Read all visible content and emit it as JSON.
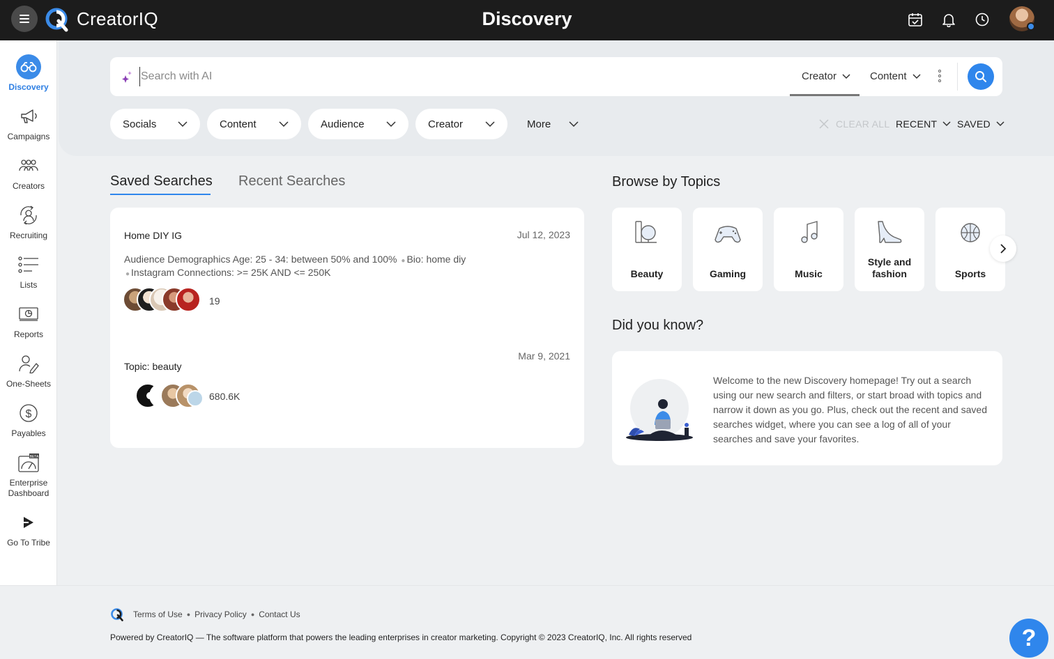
{
  "app": {
    "brand": "CreatorIQ",
    "page_title": "Discovery"
  },
  "header_icons": [
    "calendar-check-icon",
    "bell-icon",
    "clock-icon",
    "user-avatar"
  ],
  "sidebar": {
    "items": [
      {
        "label": "Discovery",
        "icon": "binoculars-icon",
        "active": true
      },
      {
        "label": "Campaigns",
        "icon": "megaphone-icon"
      },
      {
        "label": "Creators",
        "icon": "people-icon"
      },
      {
        "label": "Recruiting",
        "icon": "recruiting-icon"
      },
      {
        "label": "Lists",
        "icon": "list-icon"
      },
      {
        "label": "Reports",
        "icon": "report-icon"
      },
      {
        "label": "One-Sheets",
        "icon": "one-sheet-icon"
      },
      {
        "label": "Payables",
        "icon": "dollar-icon"
      },
      {
        "label": "Enterprise Dashboard",
        "icon": "dashboard-icon",
        "badge": "BETA"
      },
      {
        "label": "Go To Tribe",
        "icon": "tribe-icon"
      }
    ]
  },
  "search": {
    "placeholder": "Search with AI",
    "types": [
      "Creator",
      "Content"
    ],
    "active_type": "Creator"
  },
  "filters": {
    "pills": [
      "Socials",
      "Content",
      "Audience",
      "Creator"
    ],
    "more": "More",
    "clear_all": "CLEAR ALL",
    "recent": "RECENT",
    "saved": "SAVED"
  },
  "searches_tabs": {
    "saved": "Saved Searches",
    "recent": "Recent Searches",
    "active": "saved"
  },
  "saved_searches": [
    {
      "title": "Home DIY IG",
      "date": "Jul 12, 2023",
      "desc_part1": "Audience Demographics Age: 25 - 34: between 50% and 100%",
      "desc_part2": "Bio: home diy",
      "desc_part3": "Instagram Connections: >= 25K AND <= 250K",
      "count": "19"
    },
    {
      "title": "Topic: beauty",
      "date": "Mar 9, 2021",
      "count": "680.6K"
    }
  ],
  "browse": {
    "title": "Browse by Topics",
    "topics": [
      {
        "label": "Beauty",
        "icon": "mirror-icon"
      },
      {
        "label": "Gaming",
        "icon": "gamepad-icon"
      },
      {
        "label": "Music",
        "icon": "music-note-icon"
      },
      {
        "label": "Style and fashion",
        "icon": "high-heel-icon"
      },
      {
        "label": "Sports",
        "icon": "basketball-icon"
      }
    ]
  },
  "did_you_know": {
    "title": "Did you know?",
    "text": "Welcome to the new Discovery homepage! Try out a search using our new search and filters, or start broad with topics and narrow it down as you go. Plus, check out the recent and saved searches widget, where you can see a log of all of your searches and save your favorites."
  },
  "footer": {
    "links": [
      "Terms of Use",
      "Privacy Policy",
      "Contact Us"
    ],
    "powered": "Powered by CreatorIQ — The software platform that powers the leading enterprises in creator marketing. Copyright © 2023 CreatorIQ, Inc. All rights reserved",
    "help": "?"
  },
  "colors": {
    "accent": "#2f86ec",
    "topbar": "#1c1c1c",
    "background": "#eef0f2"
  }
}
